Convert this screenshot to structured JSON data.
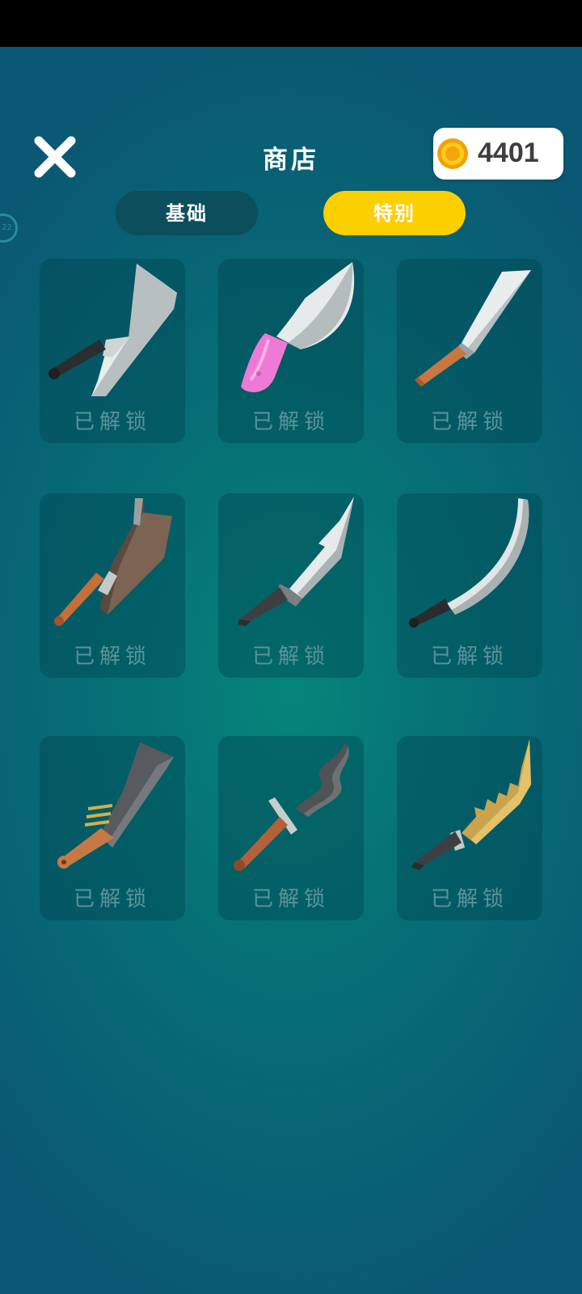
{
  "header": {
    "title": "商店",
    "close_icon": "close-x-icon",
    "coins": "4401",
    "coin_icon": "gold-coin-icon",
    "side_badge": "22"
  },
  "tabs": [
    {
      "label": "基础",
      "selected": false
    },
    {
      "label": "特别",
      "selected": true
    }
  ],
  "items": [
    {
      "icon": "cleaver-knife-icon",
      "status": "已解锁"
    },
    {
      "icon": "pink-handle-knife-icon",
      "status": "已解锁"
    },
    {
      "icon": "chef-knife-icon",
      "status": "已解锁"
    },
    {
      "icon": "dark-cleaver-icon",
      "status": "已解锁"
    },
    {
      "icon": "serrated-hunting-knife-icon",
      "status": "已解锁"
    },
    {
      "icon": "curved-blade-icon",
      "status": "已解锁"
    },
    {
      "icon": "broad-machete-icon",
      "status": "已解锁"
    },
    {
      "icon": "wavy-dagger-icon",
      "status": "已解锁"
    },
    {
      "icon": "golden-sawtooth-blade-icon",
      "status": "已解锁"
    }
  ],
  "colors": {
    "accent": "#fccf00",
    "tab_inactive": "#0b4f5c",
    "locked_text": "#5a9499"
  }
}
